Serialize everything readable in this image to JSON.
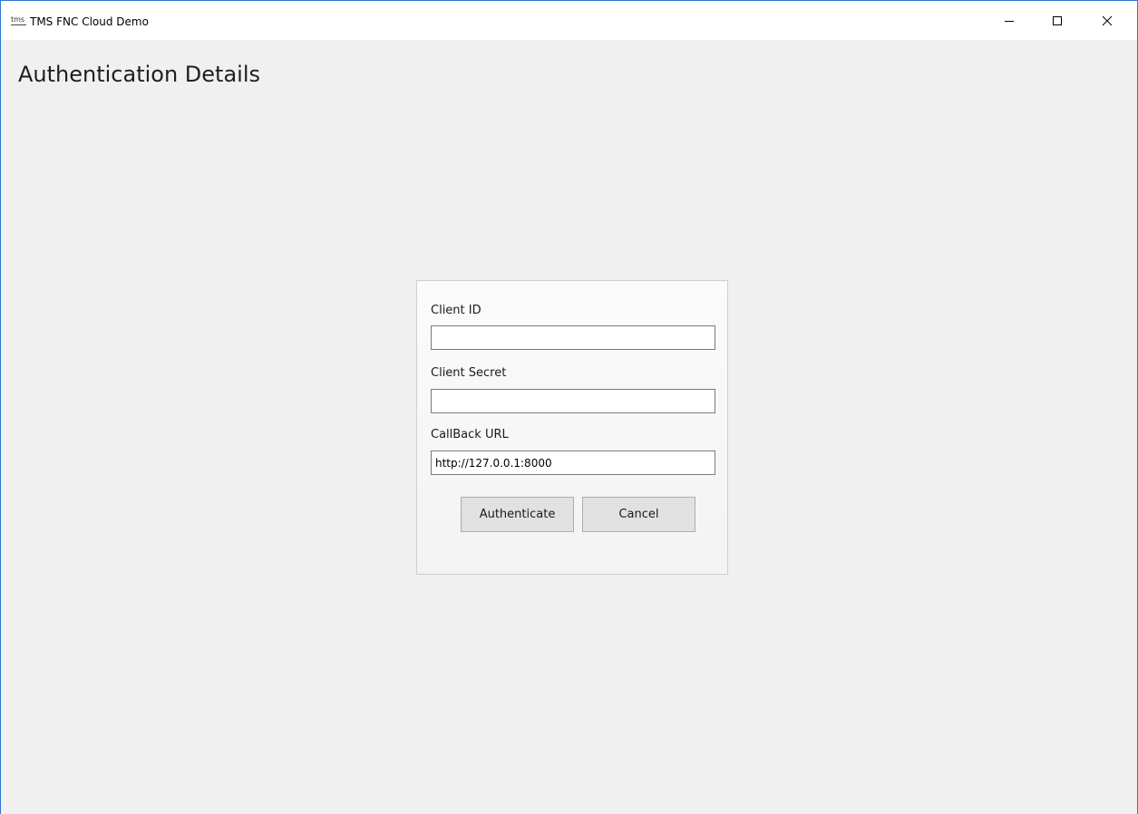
{
  "window": {
    "title": "TMS FNC Cloud Demo",
    "app_icon_text": "tms",
    "controls": {
      "minimize_icon": "minimize-icon",
      "maximize_icon": "maximize-icon",
      "close_icon": "close-icon"
    }
  },
  "page": {
    "title": "Authentication Details"
  },
  "form": {
    "client_id": {
      "label": "Client ID",
      "value": ""
    },
    "client_secret": {
      "label": "Client Secret",
      "value": ""
    },
    "callback_url": {
      "label": "CallBack URL",
      "value": "http://127.0.0.1:8000"
    },
    "authenticate_label": "Authenticate",
    "cancel_label": "Cancel"
  },
  "colors": {
    "window_border": "#2b79d0",
    "background": "#f0f0f0",
    "titlebar": "#ffffff",
    "button": "#e1e1e1"
  }
}
